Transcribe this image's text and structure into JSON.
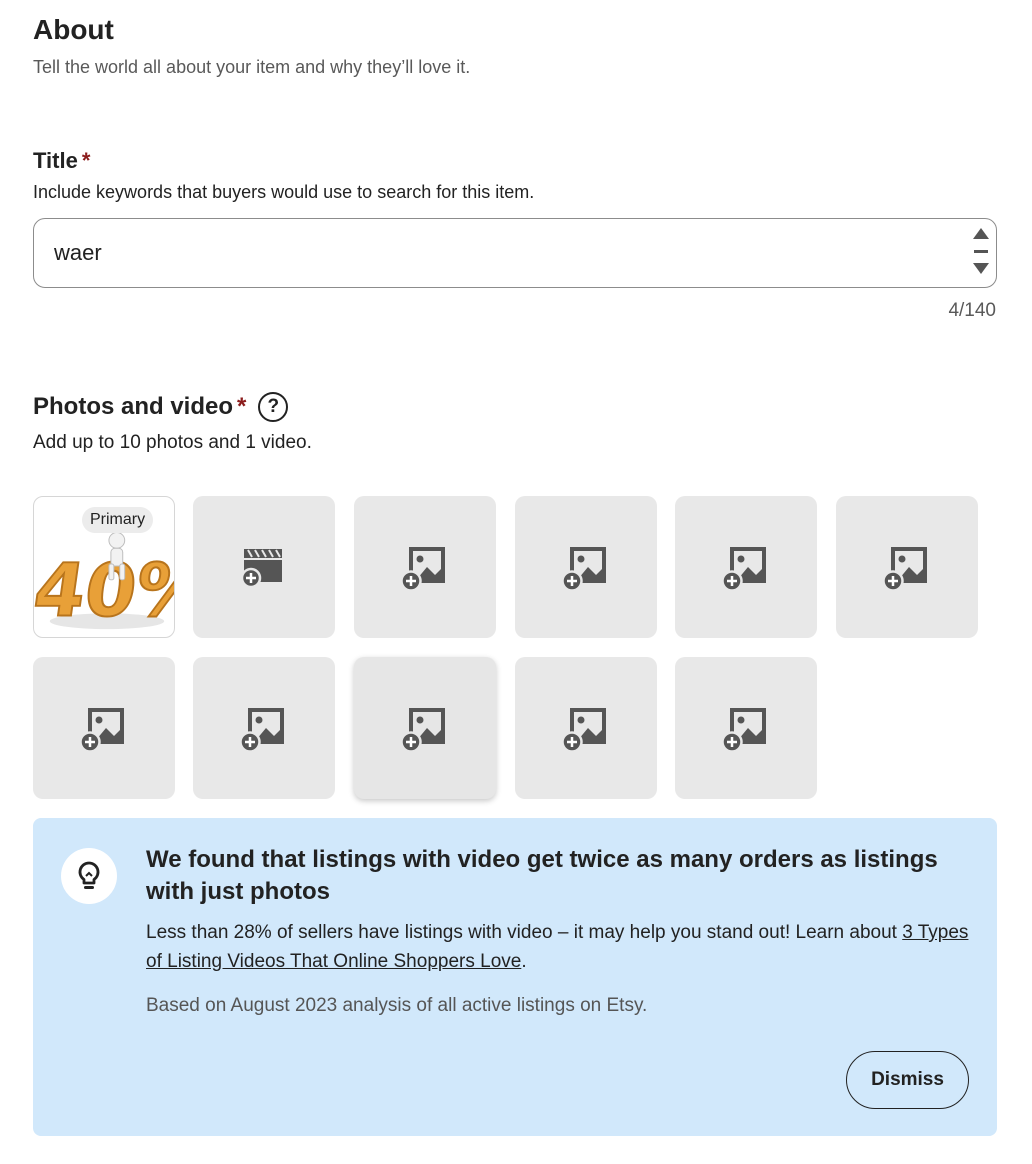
{
  "about": {
    "heading": "About",
    "subheading": "Tell the world all about your item and why they’ll love it."
  },
  "title_field": {
    "label": "Title",
    "required_mark": "*",
    "help": "Include keywords that buyers would use to search for this item.",
    "value": "waer",
    "char_count": "4/140"
  },
  "photos": {
    "label": "Photos and video",
    "required_mark": "*",
    "help_icon": "?",
    "help": "Add up to 10 photos and 1 video.",
    "primary_badge": "Primary",
    "primary_image_text": "40%",
    "slots": [
      {
        "kind": "primary-photo"
      },
      {
        "kind": "video"
      },
      {
        "kind": "photo"
      },
      {
        "kind": "photo"
      },
      {
        "kind": "photo"
      },
      {
        "kind": "photo"
      },
      {
        "kind": "photo"
      },
      {
        "kind": "photo"
      },
      {
        "kind": "photo"
      },
      {
        "kind": "photo"
      },
      {
        "kind": "photo"
      }
    ]
  },
  "tip": {
    "icon": "lightbulb-icon",
    "title": "We found that listings with video get twice as many orders as listings with just photos",
    "body_prefix": "Less than 28% of sellers have listings with video – it may help you stand out! Learn about ",
    "link_text": "3 Types of Listing Videos That Online Shoppers Love",
    "body_suffix": ".",
    "note": "Based on August 2023 analysis of all active listings on Etsy.",
    "dismiss_label": "Dismiss"
  },
  "colors": {
    "required": "#8b1c1c",
    "tip_background": "#d1e8fb",
    "tile_background": "#e8e8e8",
    "primary_image_orange": "#e8a038"
  }
}
